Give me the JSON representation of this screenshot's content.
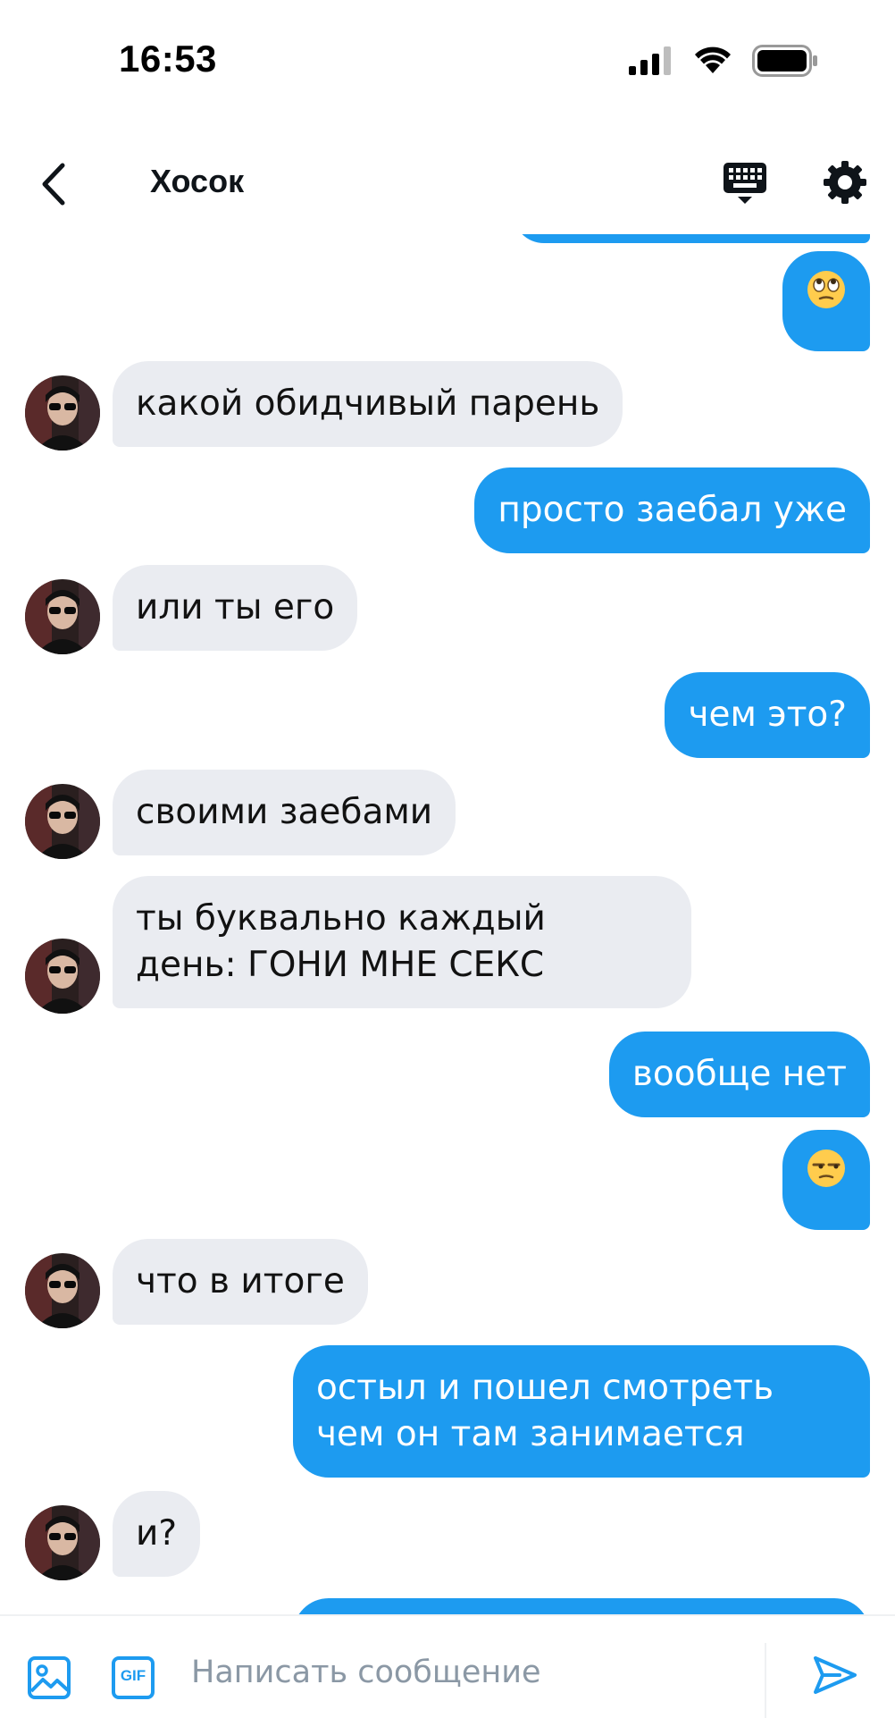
{
  "status_bar": {
    "time": "16:53"
  },
  "header": {
    "title": "Хосок"
  },
  "messages": [
    {
      "side": "out",
      "text": "🙄"
    },
    {
      "side": "in",
      "text": "какой обидчивый парень"
    },
    {
      "side": "out",
      "text": "просто заебал уже"
    },
    {
      "side": "in",
      "text": "или ты его"
    },
    {
      "side": "out",
      "text": "чем это?"
    },
    {
      "side": "in",
      "text": "своими заебами"
    },
    {
      "side": "in",
      "text_line1": "ты буквально каждый",
      "text_line2": "день: ГОНИ МНЕ СЕКС"
    },
    {
      "side": "out",
      "text": "вообще нет"
    },
    {
      "side": "out",
      "text": "😒"
    },
    {
      "side": "in",
      "text": "что в итоге"
    },
    {
      "side": "out",
      "text_line1": "остыл и пошел смотреть",
      "text_line2": "чем он там занимается"
    },
    {
      "side": "in",
      "text": "и?"
    }
  ],
  "compose": {
    "placeholder": "Написать сообщение",
    "gif_label": "GIF"
  },
  "colors": {
    "outgoing": "#1d9bf0",
    "incoming": "#eaecf1",
    "icon_accent": "#1d9bf0"
  }
}
